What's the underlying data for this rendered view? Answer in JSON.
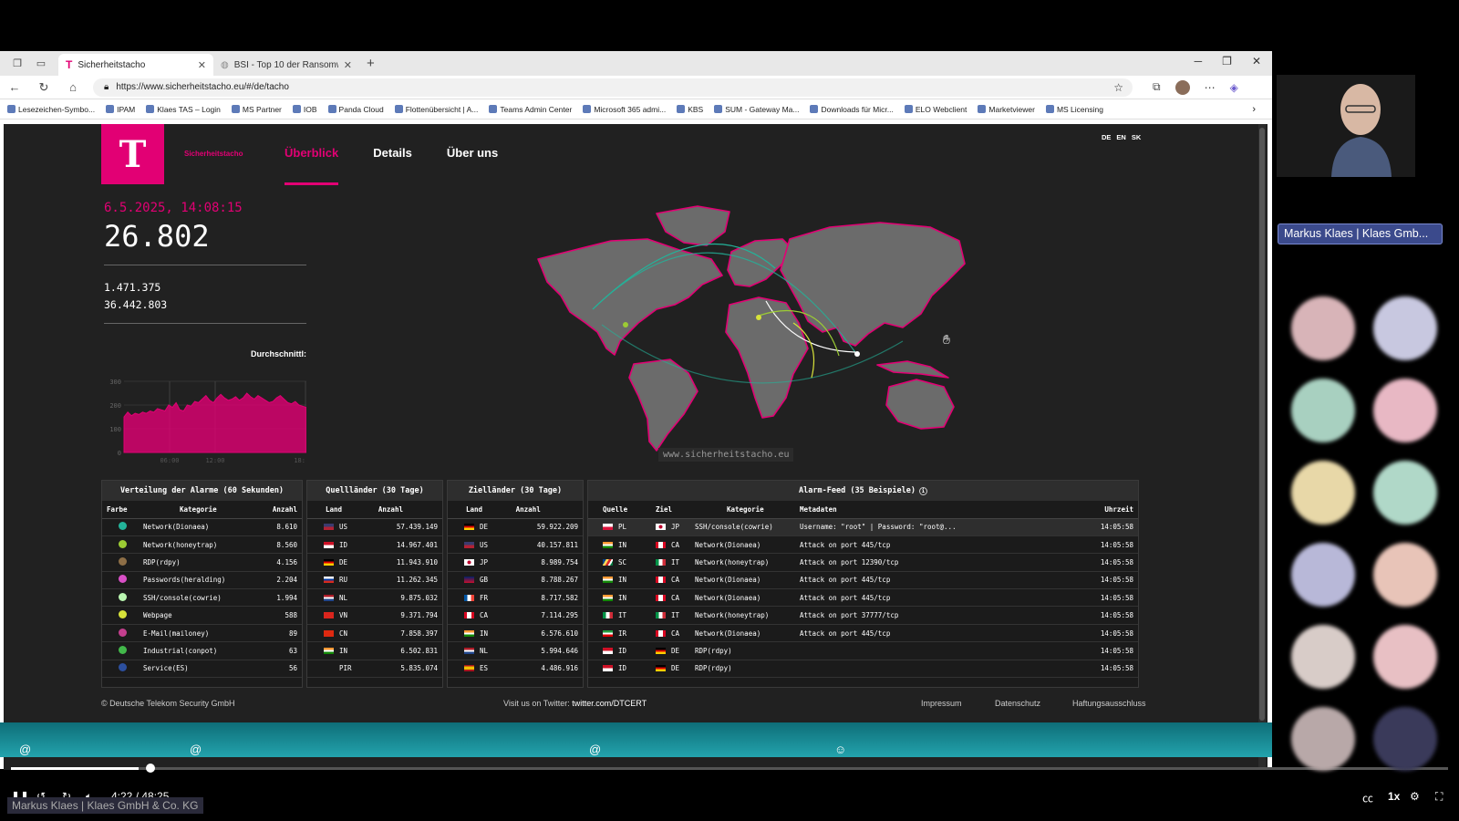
{
  "browser": {
    "tabs": [
      {
        "title": "Sicherheitstacho",
        "active": true
      },
      {
        "title": "BSI - Top 10 der Ransomware-Ma",
        "active": false
      }
    ],
    "url": "https://www.sicherheitstacho.eu/#/de/tacho",
    "bookmarks": [
      "Lesezeichen-Symbo...",
      "IPAM",
      "Klaes TAS – Login",
      "MS Partner",
      "IOB",
      "Panda Cloud",
      "Flottenübersicht | A...",
      "Teams Admin Center",
      "Microsoft 365 admi...",
      "KBS",
      "SUM - Gateway Ma...",
      "Downloads für Micr...",
      "ELO Webclient",
      "Marketviewer",
      "MS Licensing"
    ]
  },
  "site": {
    "logo_letter": "T",
    "brand": "Sicherheitstacho",
    "nav": [
      "Überblick",
      "Details",
      "Über uns"
    ],
    "languages": [
      "DE",
      "EN",
      "SK"
    ],
    "datetime": "6.5.2025, 14:08:15",
    "big_number": "26.802",
    "stat1": "1.471.375",
    "stat2": "36.442.803",
    "avg_label": "Durchschnittl:",
    "map_watermark": "www.sicherheitstacho.eu"
  },
  "chart_data": {
    "type": "area",
    "x_ticks": [
      "06:00",
      "12:00",
      "18:"
    ],
    "y_ticks": [
      0,
      100,
      200,
      300
    ],
    "ylim": [
      0,
      300
    ],
    "values": [
      150,
      170,
      155,
      165,
      160,
      170,
      165,
      175,
      170,
      185,
      180,
      175,
      200,
      190,
      210,
      180,
      175,
      200,
      195,
      215,
      210,
      225,
      240,
      220,
      210,
      230,
      245,
      230,
      220,
      225,
      235,
      220,
      230,
      250,
      235,
      225,
      240,
      230,
      220,
      210,
      215,
      230,
      240,
      225,
      210,
      205,
      215,
      200,
      195,
      190
    ],
    "color": "#e20074"
  },
  "alarm_distribution": {
    "title": "Verteilung der Alarme (60 Sekunden)",
    "headers": [
      "Farbe",
      "Kategorie",
      "Anzahl"
    ],
    "rows": [
      {
        "color": "#23b39a",
        "category": "Network(Dionaea)",
        "count": "8.610"
      },
      {
        "color": "#9ccc34",
        "category": "Network(honeytrap)",
        "count": "8.560"
      },
      {
        "color": "#8d6e46",
        "category": "RDP(rdpy)",
        "count": "4.156"
      },
      {
        "color": "#d94fc6",
        "category": "Passwords(heralding)",
        "count": "2.204"
      },
      {
        "color": "#b9f5b0",
        "category": "SSH/console(cowrie)",
        "count": "1.994"
      },
      {
        "color": "#d7e23a",
        "category": "Webpage",
        "count": "588"
      },
      {
        "color": "#c43f8e",
        "category": "E-Mail(mailoney)",
        "count": "89"
      },
      {
        "color": "#42b84a",
        "category": "Industrial(conpot)",
        "count": "63"
      },
      {
        "color": "#2c4f9e",
        "category": "Service(ES)",
        "count": "56"
      }
    ]
  },
  "source_countries": {
    "title": "Quellländer (30 Tage)",
    "headers": [
      "Land",
      "Anzahl"
    ],
    "rows": [
      {
        "flag": "us",
        "country": "US",
        "count": "57.439.149"
      },
      {
        "flag": "id",
        "country": "ID",
        "count": "14.967.401"
      },
      {
        "flag": "de",
        "country": "DE",
        "count": "11.943.910"
      },
      {
        "flag": "ru",
        "country": "RU",
        "count": "11.262.345"
      },
      {
        "flag": "nl",
        "country": "NL",
        "count": "9.875.032"
      },
      {
        "flag": "vn",
        "country": "VN",
        "count": "9.371.794"
      },
      {
        "flag": "cn",
        "country": "CN",
        "count": "7.858.397"
      },
      {
        "flag": "in",
        "country": "IN",
        "count": "6.502.831"
      },
      {
        "flag": "none",
        "country": "PIR",
        "count": "5.835.074"
      }
    ]
  },
  "target_countries": {
    "title": "Zielländer (30 Tage)",
    "headers": [
      "Land",
      "Anzahl"
    ],
    "rows": [
      {
        "flag": "de",
        "country": "DE",
        "count": "59.922.209"
      },
      {
        "flag": "us",
        "country": "US",
        "count": "40.157.811"
      },
      {
        "flag": "jp",
        "country": "JP",
        "count": "8.989.754"
      },
      {
        "flag": "gb",
        "country": "GB",
        "count": "8.788.267"
      },
      {
        "flag": "fr",
        "country": "FR",
        "count": "8.717.582"
      },
      {
        "flag": "ca",
        "country": "CA",
        "count": "7.114.295"
      },
      {
        "flag": "in",
        "country": "IN",
        "count": "6.576.610"
      },
      {
        "flag": "nl",
        "country": "NL",
        "count": "5.994.646"
      },
      {
        "flag": "es",
        "country": "ES",
        "count": "4.486.916"
      }
    ]
  },
  "alarm_feed": {
    "title": "Alarm-Feed (35 Beispiele)",
    "headers": [
      "Quelle",
      "Ziel",
      "Kategorie",
      "Metadaten",
      "Uhrzeit"
    ],
    "rows": [
      {
        "src_flag": "pl",
        "src": "PL",
        "dst_flag": "jp",
        "dst": "JP",
        "category": "SSH/console(cowrie)",
        "meta": "Username: \"root\" | Password: \"root@...",
        "time": "14:05:58"
      },
      {
        "src_flag": "in",
        "src": "IN",
        "dst_flag": "ca",
        "dst": "CA",
        "category": "Network(Dionaea)",
        "meta": "Attack on port 445/tcp",
        "time": "14:05:58"
      },
      {
        "src_flag": "sc",
        "src": "SC",
        "dst_flag": "it",
        "dst": "IT",
        "category": "Network(honeytrap)",
        "meta": "Attack on port 12390/tcp",
        "time": "14:05:58"
      },
      {
        "src_flag": "in",
        "src": "IN",
        "dst_flag": "ca",
        "dst": "CA",
        "category": "Network(Dionaea)",
        "meta": "Attack on port 445/tcp",
        "time": "14:05:58"
      },
      {
        "src_flag": "in",
        "src": "IN",
        "dst_flag": "ca",
        "dst": "CA",
        "category": "Network(Dionaea)",
        "meta": "Attack on port 445/tcp",
        "time": "14:05:58"
      },
      {
        "src_flag": "it",
        "src": "IT",
        "dst_flag": "it",
        "dst": "IT",
        "category": "Network(honeytrap)",
        "meta": "Attack on port 37777/tcp",
        "time": "14:05:58"
      },
      {
        "src_flag": "ir",
        "src": "IR",
        "dst_flag": "ca",
        "dst": "CA",
        "category": "Network(Dionaea)",
        "meta": "Attack on port 445/tcp",
        "time": "14:05:58"
      },
      {
        "src_flag": "id",
        "src": "ID",
        "dst_flag": "de",
        "dst": "DE",
        "category": "RDP(rdpy)",
        "meta": "",
        "time": "14:05:58"
      },
      {
        "src_flag": "id",
        "src": "ID",
        "dst_flag": "de",
        "dst": "DE",
        "category": "RDP(rdpy)",
        "meta": "",
        "time": "14:05:58"
      }
    ]
  },
  "footer": {
    "copyright": "© Deutsche Telekom Security GmbH",
    "twitter_prefix": "Visit us on Twitter:",
    "twitter_handle": "twitter.com/DTCERT",
    "links": [
      "Impressum",
      "Datenschutz",
      "Haftungsausschluss"
    ]
  },
  "meeting": {
    "presenter_name": "Markus Klaes | Klaes Gmb...",
    "speaker_overlay": "Markus Klaes | Klaes GmbH & Co. KG",
    "time": "4:22 / 48:25",
    "speed": "1x",
    "participant_colors": [
      "#d8b4b8",
      "#c8c8e0",
      "#a8d0c0",
      "#e8b8c4",
      "#e8d8a8",
      "#b0d8c8",
      "#b8b8d8",
      "#e8c4b8",
      "#d8ccc8",
      "#e8c0c4",
      "#b8a8a8",
      "#3a3a5a"
    ]
  }
}
